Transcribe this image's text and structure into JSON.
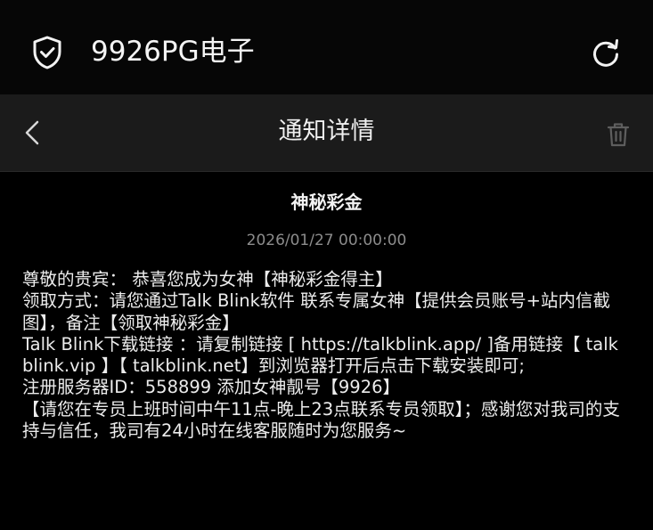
{
  "app": {
    "title": "9926PG电子",
    "shield_icon": "shield-check-icon",
    "refresh_icon": "refresh-icon"
  },
  "header": {
    "title": "通知详情",
    "back_icon": "chevron-left-icon",
    "delete_icon": "trash-icon"
  },
  "message": {
    "title": "神秘彩金",
    "timestamp": "2026/01/27 00:00:00",
    "body": "尊敬的贵宾： 恭喜您成为女神【神秘彩金得主】\n领取方式：请您通过Talk Blink软件 联系专属女神【提供会员账号+站内信截图】，备注【领取神秘彩金】\nTalk Blink下载链接 ：请复制链接 [ https://talkblink.app/ ]备用链接【 talkblink.vip 】【 talkblink.net】到浏览器打开后点击下载安装即可;\n注册服务器ID：558899 添加女神靓号【9926】\n【请您在专员上班时间中午11点-晚上23点联系专员领取】；感谢您对我司的支持与信任，我司有24小时在线客服随时为您服务~"
  },
  "colors": {
    "background": "#000000",
    "header_bar": "#1b1b1b",
    "text_primary": "#f0f0f0",
    "text_secondary": "#8c8c8c"
  }
}
